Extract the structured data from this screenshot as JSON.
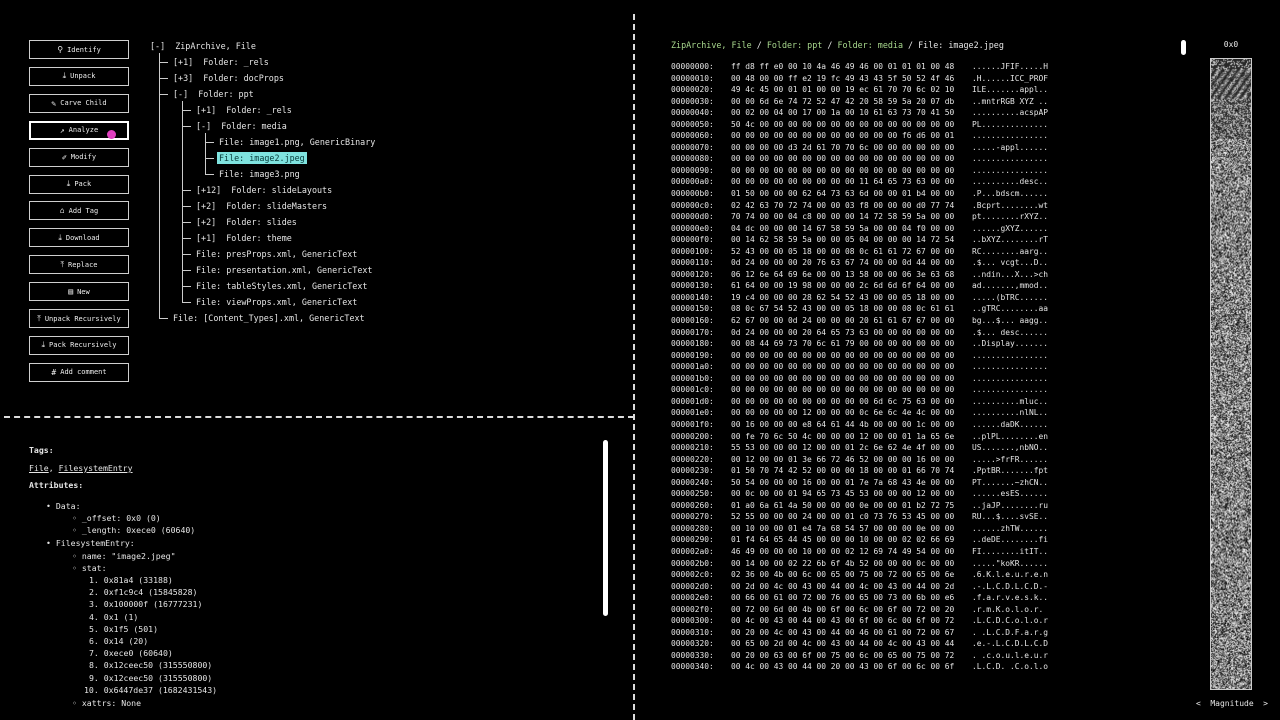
{
  "toolbar": {
    "buttons": [
      {
        "label": "Identify",
        "icon": "search-icon",
        "glyph": "⚲"
      },
      {
        "label": "Unpack",
        "icon": "unpack-icon",
        "glyph": "⤓"
      },
      {
        "label": "Carve Child",
        "icon": "pencil-icon",
        "glyph": "✎"
      },
      {
        "label": "Analyze",
        "icon": "trend-icon",
        "glyph": "↗"
      },
      {
        "label": "Modify",
        "icon": "modify-icon",
        "glyph": "✐"
      },
      {
        "label": "Pack",
        "icon": "pack-icon",
        "glyph": "⤓"
      },
      {
        "label": "Add Tag",
        "icon": "tag-icon",
        "glyph": "⌂"
      },
      {
        "label": "Download",
        "icon": "download-icon",
        "glyph": "⤓"
      },
      {
        "label": "Replace",
        "icon": "upload-icon",
        "glyph": "⤒"
      },
      {
        "label": "New",
        "icon": "file-icon",
        "glyph": "▤"
      },
      {
        "label": "Unpack Recursively",
        "icon": "unpack-recursive-icon",
        "glyph": "⤒"
      },
      {
        "label": "Pack Recursively",
        "icon": "pack-recursive-icon",
        "glyph": "⤓"
      },
      {
        "label": "Add comment",
        "icon": "hash-icon",
        "glyph": "#"
      }
    ]
  },
  "tree": [
    {
      "text": "[-]  ZipArchive, File",
      "depth": 0
    },
    {
      "text": "[+1]  Folder: _rels",
      "depth": 1
    },
    {
      "text": "[+3]  Folder: docProps",
      "depth": 1
    },
    {
      "text": "[-]  Folder: ppt",
      "depth": 1
    },
    {
      "text": "[+1]  Folder: _rels",
      "depth": 2
    },
    {
      "text": "[-]  Folder: media",
      "depth": 2
    },
    {
      "text": "File: image1.png, GenericBinary",
      "depth": 3
    },
    {
      "text": "File: image2.jpeg",
      "depth": 3,
      "selected": true
    },
    {
      "text": "File: image3.png",
      "depth": 3
    },
    {
      "text": "[+12]  Folder: slideLayouts",
      "depth": 2
    },
    {
      "text": "[+2]  Folder: slideMasters",
      "depth": 2
    },
    {
      "text": "[+2]  Folder: slides",
      "depth": 2
    },
    {
      "text": "[+1]  Folder: theme",
      "depth": 2
    },
    {
      "text": "File: presProps.xml, GenericText",
      "depth": 2
    },
    {
      "text": "File: presentation.xml, GenericText",
      "depth": 2
    },
    {
      "text": "File: tableStyles.xml, GenericText",
      "depth": 2
    },
    {
      "text": "File: viewProps.xml, GenericText",
      "depth": 2
    },
    {
      "text": "File: [Content_Types].xml, GenericText",
      "depth": 1
    }
  ],
  "details": {
    "tags_label": "Tags:",
    "tags": [
      "File",
      "FilesystemEntry"
    ],
    "tags_sep": ",",
    "attributes_label": "Attributes:",
    "data_label": "Data:",
    "offset": "_offset: 0x0 (0)",
    "length": "_length: 0xece0 (60640)",
    "fse_label": "FilesystemEntry:",
    "name": "name: \"image2.jpeg\"",
    "stat_label": "stat:",
    "stat": [
      "0x81a4 (33188)",
      "0xf1c9c4 (15845828)",
      "0x100000f (16777231)",
      "0x1 (1)",
      "0x1f5 (501)",
      "0x14 (20)",
      "0xece0 (60640)",
      "0x12ceec50 (315550800)",
      "0x12ceec50 (315550800)",
      "0x6447de37 (1682431543)"
    ],
    "xattrs": "xattrs: None"
  },
  "breadcrumb": {
    "items": [
      "ZipArchive, File",
      "Folder: ppt",
      "Folder: media"
    ],
    "current": "File: image2.jpeg",
    "sep": "/"
  },
  "hex_rows": [
    [
      "00000000:",
      "ff d8 ff e0 00 10 4a 46 49 46 00 01 01 01 00 48",
      "......JFIF.....H"
    ],
    [
      "00000010:",
      "00 48 00 00 ff e2 19 fc 49 43 43 5f 50 52 4f 46",
      ".H......ICC_PROF"
    ],
    [
      "00000020:",
      "49 4c 45 00 01 01 00 00 19 ec 61 70 70 6c 02 10",
      "ILE.......appl.."
    ],
    [
      "00000030:",
      "00 00 6d 6e 74 72 52 47 42 20 58 59 5a 20 07 db",
      "..mntrRGB XYZ .."
    ],
    [
      "00000040:",
      "00 02 00 04 00 17 00 1a 00 10 61 63 73 70 41 50",
      "..........acspAP"
    ],
    [
      "00000050:",
      "50 4c 00 00 00 00 00 00 00 00 00 00 00 00 00 00",
      "PL.............."
    ],
    [
      "00000060:",
      "00 00 00 00 00 00 00 00 00 00 00 00 f6 d6 00 01",
      "................"
    ],
    [
      "00000070:",
      "00 00 00 00 d3 2d 61 70 70 6c 00 00 00 00 00 00",
      ".....-appl......"
    ],
    [
      "00000080:",
      "00 00 00 00 00 00 00 00 00 00 00 00 00 00 00 00",
      "................"
    ],
    [
      "00000090:",
      "00 00 00 00 00 00 00 00 00 00 00 00 00 00 00 00",
      "................"
    ],
    [
      "000000a0:",
      "00 00 00 00 00 00 00 00 00 11 64 65 73 63 00 00",
      "..........desc.."
    ],
    [
      "000000b0:",
      "01 50 00 00 00 62 64 73 63 6d 00 00 01 b4 00 00",
      ".P...bdscm......"
    ],
    [
      "000000c0:",
      "02 42 63 70 72 74 00 00 03 f8 00 00 00 d0 77 74",
      ".Bcprt........wt"
    ],
    [
      "000000d0:",
      "70 74 00 00 04 c8 00 00 00 14 72 58 59 5a 00 00",
      "pt........rXYZ.."
    ],
    [
      "000000e0:",
      "04 dc 00 00 00 14 67 58 59 5a 00 00 04 f0 00 00",
      "......gXYZ......"
    ],
    [
      "000000f0:",
      "00 14 62 58 59 5a 00 00 05 04 00 00 00 14 72 54",
      "..bXYZ........rT"
    ],
    [
      "00000100:",
      "52 43 00 00 05 18 00 00 08 0c 61 61 72 67 00 00",
      "RC........aarg.."
    ],
    [
      "00000110:",
      "0d 24 00 00 00 20 76 63 67 74 00 00 0d 44 00 00",
      ".$... vcgt...D.."
    ],
    [
      "00000120:",
      "06 12 6e 64 69 6e 00 00 13 58 00 00 06 3e 63 68",
      "..ndin...X...>ch"
    ],
    [
      "00000130:",
      "61 64 00 00 19 98 00 00 00 2c 6d 6d 6f 64 00 00",
      "ad.......,mmod.."
    ],
    [
      "00000140:",
      "19 c4 00 00 00 28 62 54 52 43 00 00 05 18 00 00",
      ".....(bTRC......"
    ],
    [
      "00000150:",
      "08 0c 67 54 52 43 00 00 05 18 00 00 08 0c 61 61",
      "..gTRC........aa"
    ],
    [
      "00000160:",
      "62 67 00 00 0d 24 00 00 00 20 61 61 67 67 00 00",
      "bg...$... aagg.."
    ],
    [
      "00000170:",
      "0d 24 00 00 00 20 64 65 73 63 00 00 00 00 00 00",
      ".$... desc......"
    ],
    [
      "00000180:",
      "00 08 44 69 73 70 6c 61 79 00 00 00 00 00 00 00",
      "..Display......."
    ],
    [
      "00000190:",
      "00 00 00 00 00 00 00 00 00 00 00 00 00 00 00 00",
      "................"
    ],
    [
      "000001a0:",
      "00 00 00 00 00 00 00 00 00 00 00 00 00 00 00 00",
      "................"
    ],
    [
      "000001b0:",
      "00 00 00 00 00 00 00 00 00 00 00 00 00 00 00 00",
      "................"
    ],
    [
      "000001c0:",
      "00 00 00 00 00 00 00 00 00 00 00 00 00 00 00 00",
      "................"
    ],
    [
      "000001d0:",
      "00 00 00 00 00 00 00 00 00 00 6d 6c 75 63 00 00",
      "..........mluc.."
    ],
    [
      "000001e0:",
      "00 00 00 00 00 12 00 00 00 0c 6e 6c 4e 4c 00 00",
      "..........nlNL.."
    ],
    [
      "000001f0:",
      "00 16 00 00 00 e8 64 61 44 4b 00 00 00 1c 00 00",
      "......daDK......"
    ],
    [
      "00000200:",
      "00 fe 70 6c 50 4c 00 00 00 12 00 00 01 1a 65 6e",
      "..plPL........en"
    ],
    [
      "00000210:",
      "55 53 00 00 00 12 00 00 01 2c 6e 62 4e 4f 00 00",
      "US.......,nbNO.."
    ],
    [
      "00000220:",
      "00 12 00 00 01 3e 66 72 46 52 00 00 00 16 00 00",
      ".....>frFR......"
    ],
    [
      "00000230:",
      "01 50 70 74 42 52 00 00 00 18 00 00 01 66 70 74",
      ".PptBR.......fpt"
    ],
    [
      "00000240:",
      "50 54 00 00 00 16 00 00 01 7e 7a 68 43 4e 00 00",
      "PT.......~zhCN.."
    ],
    [
      "00000250:",
      "00 0c 00 00 01 94 65 73 45 53 00 00 00 12 00 00",
      "......esES......"
    ],
    [
      "00000260:",
      "01 a0 6a 61 4a 50 00 00 00 0e 00 00 01 b2 72 75",
      "..jaJP........ru"
    ],
    [
      "00000270:",
      "52 55 00 00 00 24 00 00 01 c0 73 76 53 45 00 00",
      "RU...$....svSE.."
    ],
    [
      "00000280:",
      "00 10 00 00 01 e4 7a 68 54 57 00 00 00 0e 00 00",
      "......zhTW......"
    ],
    [
      "00000290:",
      "01 f4 64 65 44 45 00 00 00 10 00 00 02 02 66 69",
      "..deDE........fi"
    ],
    [
      "000002a0:",
      "46 49 00 00 00 10 00 00 02 12 69 74 49 54 00 00",
      "FI........itIT.."
    ],
    [
      "000002b0:",
      "00 14 00 00 02 22 6b 6f 4b 52 00 00 00 0c 00 00",
      ".....\"koKR......"
    ],
    [
      "000002c0:",
      "02 36 00 4b 00 6c 00 65 00 75 00 72 00 65 00 6e",
      ".6.K.l.e.u.r.e.n"
    ],
    [
      "000002d0:",
      "00 2d 00 4c 00 43 00 44 00 4c 00 43 00 44 00 2d",
      ".-.L.C.D.L.C.D.-"
    ],
    [
      "000002e0:",
      "00 66 00 61 00 72 00 76 00 65 00 73 00 6b 00 e6",
      ".f.a.r.v.e.s.k.."
    ],
    [
      "000002f0:",
      "00 72 00 6d 00 4b 00 6f 00 6c 00 6f 00 72 00 20",
      ".r.m.K.o.l.o.r. "
    ],
    [
      "00000300:",
      "00 4c 00 43 00 44 00 43 00 6f 00 6c 00 6f 00 72",
      ".L.C.D.C.o.l.o.r"
    ],
    [
      "00000310:",
      "00 20 00 4c 00 43 00 44 00 46 00 61 00 72 00 67",
      ". .L.C.D.F.a.r.g"
    ],
    [
      "00000320:",
      "00 65 00 2d 00 4c 00 43 00 44 00 4c 00 43 00 44",
      ".e.-.L.C.D.L.C.D"
    ],
    [
      "00000330:",
      "00 20 00 63 00 6f 00 75 00 6c 00 65 00 75 00 72",
      ". .c.o.u.l.e.u.r"
    ],
    [
      "00000340:",
      "00 4c 00 43 00 44 00 20 00 43 00 6f 00 6c 00 6f",
      ".L.C.D. .C.o.l.o"
    ]
  ],
  "minimap": {
    "address": "0x0",
    "mode": "Magnitude",
    "prev": "<",
    "next": ">"
  },
  "colors": {
    "selected_bg": "#7fe3df",
    "crumb_link": "#a9d98e"
  }
}
